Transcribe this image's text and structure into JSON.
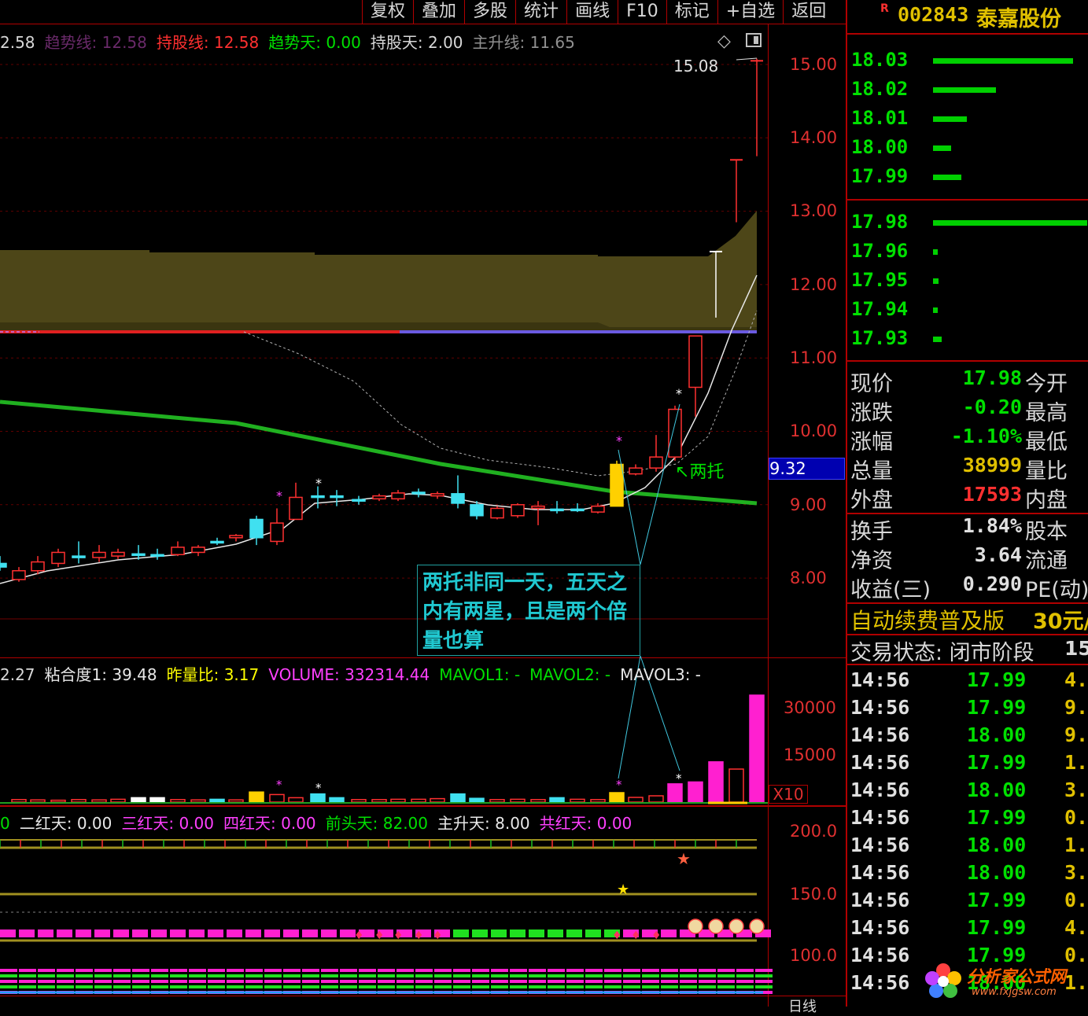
{
  "toolbar": [
    "复权",
    "叠加",
    "多股",
    "统计",
    "画线",
    "F10",
    "标记",
    "+自选",
    "返回"
  ],
  "main_indicators": [
    {
      "text": "2.58",
      "color": "#d8d8d8"
    },
    {
      "text": "趋势线: 12.58",
      "color": "#6a2a6a"
    },
    {
      "text": "持股线: 12.58",
      "color": "#ff3030"
    },
    {
      "text": "趋势天: 0.00",
      "color": "#00e000"
    },
    {
      "text": "持股天: 2.00",
      "color": "#d8d8d8"
    },
    {
      "text": "主升线: 11.65",
      "color": "#909090"
    }
  ],
  "price_axis": [
    "15.00",
    "14.00",
    "13.00",
    "12.00",
    "11.00",
    "10.00",
    "9.00",
    "8.00"
  ],
  "high_label": "15.08",
  "cursor_price": "9.32",
  "callout_label": "两托",
  "annotation": "两托非同一天，五天之内有两星，且是两个倍量也算",
  "vol_indicators": [
    {
      "text": "2.27",
      "color": "#d8d8d8"
    },
    {
      "text": "粘合度1: 39.48",
      "color": "#e8e8e8"
    },
    {
      "text": "昨量比: 3.17",
      "color": "#ffff00"
    },
    {
      "text": "VOLUME: 332314.44",
      "color": "#ff40ff"
    },
    {
      "text": "MAVOL1: -",
      "color": "#00e000"
    },
    {
      "text": "MAVOL2: -",
      "color": "#00e000"
    },
    {
      "text": "MAVOL3: -",
      "color": "#e8e8e8"
    }
  ],
  "vol_axis": [
    "30000",
    "15000"
  ],
  "vol_unit": "X10",
  "sig_indicators": [
    {
      "text": "0",
      "color": "#00e000"
    },
    {
      "text": "二红天: 0.00",
      "color": "#e8e8e8"
    },
    {
      "text": "三红天: 0.00",
      "color": "#ff40ff"
    },
    {
      "text": "四红天: 0.00",
      "color": "#ff40ff"
    },
    {
      "text": "前头天: 82.00",
      "color": "#00e000"
    },
    {
      "text": "主升天: 8.00",
      "color": "#e8e8e8"
    },
    {
      "text": "共红天: 0.00",
      "color": "#ff40ff"
    }
  ],
  "sig_axis": [
    "200.0",
    "150.0",
    "100.0"
  ],
  "bottom_tab": "日线",
  "stock": {
    "badge": "R",
    "code": "002843",
    "name": "泰嘉股份"
  },
  "order_book": [
    {
      "price": "18.03",
      "frac": 1.0
    },
    {
      "price": "18.02",
      "frac": 0.45
    },
    {
      "price": "18.01",
      "frac": 0.24
    },
    {
      "price": "18.00",
      "frac": 0.13
    },
    {
      "price": "17.99",
      "frac": 0.2
    },
    {
      "price": "17.98",
      "frac": 1.1
    },
    {
      "price": "17.96",
      "frac": 0.03
    },
    {
      "price": "17.95",
      "frac": 0.04
    },
    {
      "price": "17.94",
      "frac": 0.03
    },
    {
      "price": "17.93",
      "frac": 0.06
    }
  ],
  "quotes": [
    {
      "label": "现价",
      "value": "17.98",
      "color": "#00e000",
      "label2": "今开"
    },
    {
      "label": "涨跌",
      "value": "-0.20",
      "color": "#00e000",
      "label2": "最高"
    },
    {
      "label": "涨幅",
      "value": "-1.10%",
      "color": "#00e000",
      "label2": "最低"
    },
    {
      "label": "总量",
      "value": "38999",
      "color": "#e0c000",
      "label2": "量比"
    },
    {
      "label": "外盘",
      "value": "17593",
      "color": "#ff3030",
      "label2": "内盘"
    },
    {
      "label": "换手",
      "value": "1.84%",
      "color": "#e0e0e0",
      "label2": "股本"
    },
    {
      "label": "净资",
      "value": "3.64",
      "color": "#e0e0e0",
      "label2": "流通"
    },
    {
      "label": "收益(三)",
      "value": "0.290",
      "color": "#e0e0e0",
      "label2": "PE(动)"
    }
  ],
  "promo": "自动续费普及版",
  "promo_price": "30元/",
  "trade_status": "交易状态: 闭市阶段",
  "trade_status_tail": "15",
  "ticks": [
    {
      "time": "14:56",
      "price": "17.99",
      "vol": "4."
    },
    {
      "time": "14:56",
      "price": "17.99",
      "vol": "9."
    },
    {
      "time": "14:56",
      "price": "18.00",
      "vol": "9."
    },
    {
      "time": "14:56",
      "price": "17.99",
      "vol": "1."
    },
    {
      "time": "14:56",
      "price": "18.00",
      "vol": "3."
    },
    {
      "time": "14:56",
      "price": "17.99",
      "vol": "0."
    },
    {
      "time": "14:56",
      "price": "18.00",
      "vol": "1."
    },
    {
      "time": "14:56",
      "price": "18.00",
      "vol": "3."
    },
    {
      "time": "14:56",
      "price": "17.99",
      "vol": "0."
    },
    {
      "time": "14:56",
      "price": "17.99",
      "vol": "4."
    },
    {
      "time": "14:56",
      "price": "17.99",
      "vol": "0."
    },
    {
      "time": "14:56",
      "price": "18.00",
      "vol": "1."
    }
  ],
  "watermark": {
    "site": "分析家公式网",
    "url": "www.fxjgsw.com"
  }
}
